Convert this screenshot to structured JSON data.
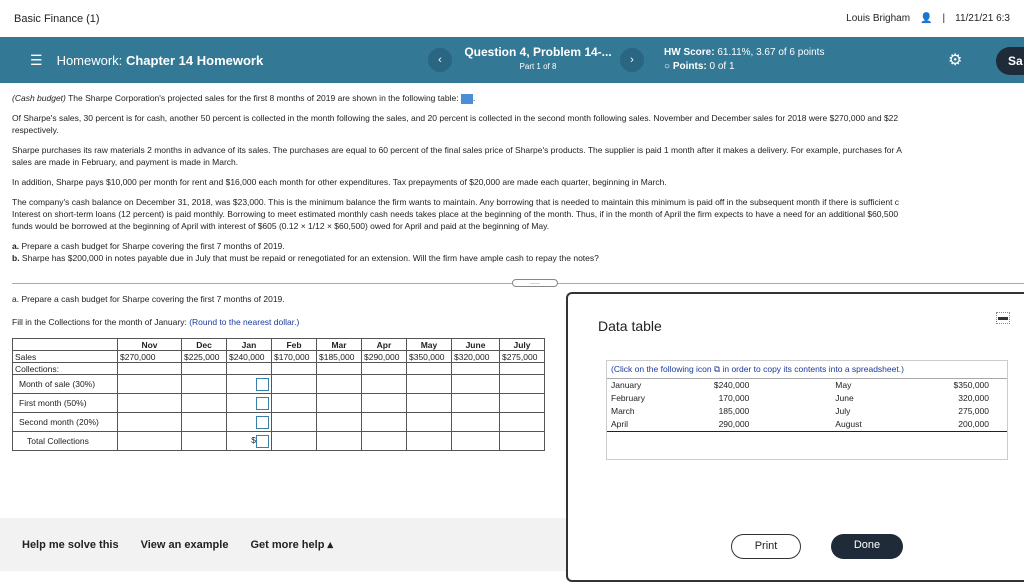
{
  "top": {
    "course": "Basic Finance (1)",
    "user": "Louis Brigham",
    "datetime": "11/21/21 6:3"
  },
  "nav": {
    "homework_prefix": "Homework:",
    "homework_title": "Chapter 14 Homework",
    "question": "Question 4, Problem 14-...",
    "part": "Part 1 of 8",
    "hw_score_label": "HW Score:",
    "hw_score": "61.11%, 3.67 of 6 points",
    "points_label": "Points:",
    "points": "0 of 1",
    "save": "Sa"
  },
  "problem": {
    "p1_italic": "(Cash budget)",
    "p1": " The Sharpe Corporation's projected sales for the first 8 months of 2019 are shown in the following table:",
    "p2a": "Of Sharpe's sales, 30 percent is for cash, another 50 percent is collected in the month following the sales, and 20 percent is collected in the second month following sales. November and December sales for 2018 were $270,000 and $22",
    "p2b": "respectively.",
    "p3a": "Sharpe purchases its raw materials 2 months in advance of its sales. The purchases are equal to 60 percent of the final sales price of Sharpe's products. The supplier is paid 1 month after it makes a delivery. For example, purchases for A",
    "p3b": "sales are made in February, and payment is made in March.",
    "p4": "In addition, Sharpe pays $10,000 per month for rent and $16,000 each month for other expenditures. Tax prepayments of $20,000 are made each quarter, beginning in March.",
    "p5a": "The company's cash balance on December 31, 2018, was $23,000. This is the minimum balance the firm wants to maintain. Any borrowing that is needed to maintain this minimum is paid off in the subsequent month if there is sufficient c",
    "p5b": "Interest on short-term loans (12 percent) is paid monthly. Borrowing to meet estimated monthly cash needs takes place at the beginning of the month. Thus, if in the month of April the firm expects to have a need for an additional $60,500",
    "p5c": "funds would be borrowed at the beginning of April with interest of $605 (0.12 × 1/12 × $60,500) owed for April and paid at the beginning of May.",
    "qa_l": "a.",
    "qa": " Prepare a cash budget for Sharpe covering the first 7 months of 2019.",
    "qb_l": "b.",
    "qb": " Sharpe has $200,000 in notes payable due in July that must be repaid or renegotiated for an extension. Will the firm have ample cash to repay the notes?"
  },
  "part_a": {
    "prompt": "a. Prepare a cash budget for Sharpe covering the first 7 months of 2019.",
    "fill": "Fill in the Collections for the month of January:",
    "note": "(Round to the nearest dollar.)"
  },
  "worktable": {
    "months": [
      "Nov",
      "Dec",
      "Jan",
      "Feb",
      "Mar",
      "Apr",
      "May",
      "June",
      "July"
    ],
    "sales_label": "Sales",
    "sales": [
      "$270,000",
      "$225,000",
      "$240,000",
      "$170,000",
      "$185,000",
      "$290,000",
      "$350,000",
      "$320,000",
      "$275,000"
    ],
    "collections_label": "Collections:",
    "rows": [
      "Month of sale (30%)",
      "First month (50%)",
      "Second month (20%)",
      "Total Collections"
    ],
    "dollar": "$",
    "inputs": {
      "month_of_sale": "",
      "first_month": "",
      "second_month": "",
      "total": ""
    }
  },
  "bottom": {
    "help": "Help me solve this",
    "example": "View an example",
    "more": "Get more help ▴"
  },
  "dialog": {
    "title": "Data table",
    "click_a": "(Click on the following icon",
    "click_b": "in order to copy its contents into a spreadsheet.)",
    "rows": [
      [
        "January",
        "$240,000",
        "May",
        "$350,000"
      ],
      [
        "February",
        "170,000",
        "June",
        "320,000"
      ],
      [
        "March",
        "185,000",
        "July",
        "275,000"
      ],
      [
        "April",
        "290,000",
        "August",
        "200,000"
      ]
    ],
    "print": "Print",
    "done": "Done"
  }
}
